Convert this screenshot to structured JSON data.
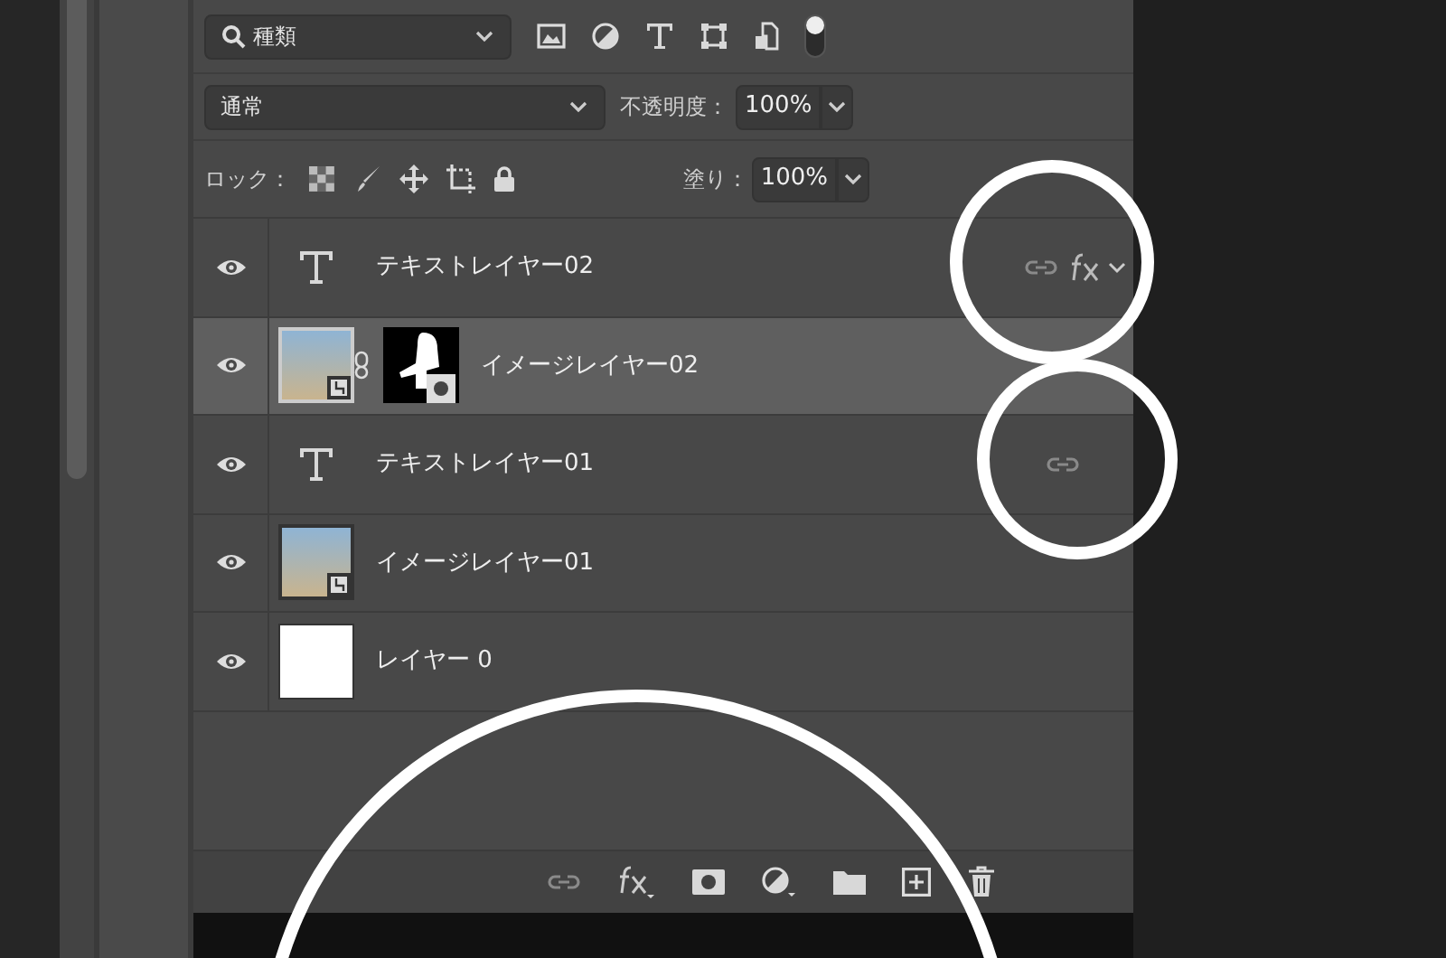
{
  "filter": {
    "kind": "種類",
    "toggle_on": true
  },
  "blend_mode": "通常",
  "opacity": {
    "label": "不透明度：",
    "value": "100%"
  },
  "lock": {
    "label": "ロック："
  },
  "fill": {
    "label": "塗り：",
    "value": "100%"
  },
  "layers": [
    {
      "kind": "text",
      "name": "テキストレイヤー02",
      "visible": true,
      "selected": false,
      "linked": true,
      "fx": true
    },
    {
      "kind": "image",
      "name": "イメージレイヤー02",
      "visible": true,
      "selected": true,
      "linked": false,
      "fx": false,
      "mask": true
    },
    {
      "kind": "text",
      "name": "テキストレイヤー01",
      "visible": true,
      "selected": false,
      "linked": true,
      "fx": false
    },
    {
      "kind": "image",
      "name": "イメージレイヤー01",
      "visible": true,
      "selected": false,
      "linked": false,
      "fx": false,
      "mask": false
    },
    {
      "kind": "fill",
      "name": "レイヤー 0",
      "visible": true,
      "selected": false,
      "linked": false,
      "fx": false
    }
  ]
}
